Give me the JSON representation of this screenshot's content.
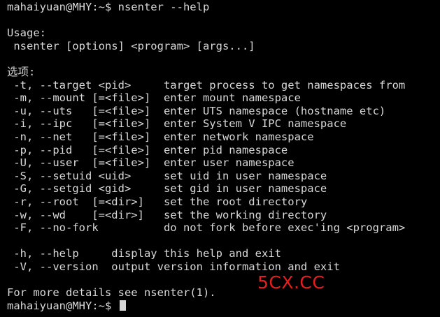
{
  "terminal": {
    "lines": [
      "mahaiyuan@MHY:~$ nsenter --help",
      "",
      "Usage:",
      " nsenter [options] <program> [args...]",
      "",
      "选项:",
      " -t, --target <pid>     target process to get namespaces from",
      " -m, --mount [=<file>]  enter mount namespace",
      " -u, --uts   [=<file>]  enter UTS namespace (hostname etc)",
      " -i, --ipc   [=<file>]  enter System V IPC namespace",
      " -n, --net   [=<file>]  enter network namespace",
      " -p, --pid   [=<file>]  enter pid namespace",
      " -U, --user  [=<file>]  enter user namespace",
      " -S, --setuid <uid>     set uid in user namespace",
      " -G, --setgid <gid>     set gid in user namespace",
      " -r, --root  [=<dir>]   set the root directory",
      " -w, --wd    [=<dir>]   set the working directory",
      " -F, --no-fork          do not fork before exec'ing <program>",
      "",
      " -h, --help     display this help and exit",
      " -V, --version  output version information and exit",
      "",
      "For more details see nsenter(1)."
    ],
    "prompt": "mahaiyuan@MHY:~$ ",
    "watermark": "5CX.CC",
    "colors": {
      "background": "#000000",
      "text": "#d8d8d8",
      "watermark": "#e81e1e"
    }
  }
}
